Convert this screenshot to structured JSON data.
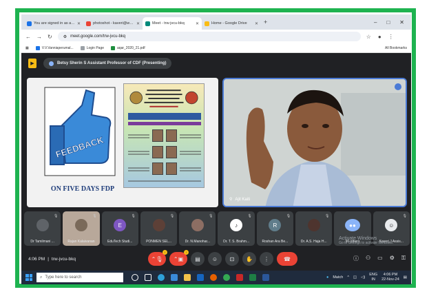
{
  "browser": {
    "tabs": [
      {
        "label": "You are signed in as agsc",
        "active": false,
        "color": "#1a73e8"
      },
      {
        "label": "photoshot - kaveri@wosdesgn -",
        "active": false,
        "color": "#ea4335"
      },
      {
        "label": "Meet - trw-jvcu-bkq",
        "active": true,
        "color": "#00897b"
      },
      {
        "label": "Home - Google Drive",
        "active": false,
        "color": "#f9bc15"
      }
    ],
    "url": "meet.google.com/trw-jvcu-bkq",
    "bookmarks": [
      "V.V.Vanniaperumal...",
      "Login Page",
      "aqar_2020_21.pdf"
    ],
    "all_bookmarks": "All Bookmarks"
  },
  "meet": {
    "presenting_label": "Betsy Sherin S Assistant Professor of CDF (Presenting)",
    "slide_caption": "ON FIVE DAYS FDP",
    "feedback_text": "FEEDBACK",
    "camera_name": "Ajit Kaiti",
    "participants": [
      {
        "name": "Dr Tamilmani ...",
        "initial": "",
        "color": "#5f6368"
      },
      {
        "name": "Rajan Kalaivanan",
        "initial": "",
        "color": "#7a6a5a"
      },
      {
        "name": "EduTech Studi...",
        "initial": "E",
        "color": "#7e57c2"
      },
      {
        "name": "PONMEN SEL...",
        "initial": "",
        "color": "#5d4037"
      },
      {
        "name": "Dr. N.Manohar...",
        "initial": "",
        "color": "#5f6368"
      },
      {
        "name": "Dr. T. S. Brahm...",
        "initial": "",
        "color": "#ffffff"
      },
      {
        "name": "Roshan Ara Be...",
        "initial": "R",
        "color": "#607d8b"
      },
      {
        "name": "Dr. A.S. Haja H...",
        "initial": "",
        "color": "#5f6368"
      },
      {
        "name": "90 others",
        "initial": "",
        "color": "#8ab4f8"
      },
      {
        "name": "Kaveri.J Assis...",
        "initial": "",
        "color": "#5f6368"
      }
    ],
    "time": "4:06 PM",
    "meeting_code": "trw-jvcu-bkq",
    "activate_title": "Activate Windows",
    "activate_sub": "Go to Settings to activate Windows."
  },
  "taskbar": {
    "search_placeholder": "Type here to search",
    "weather": "Match",
    "lang": "ENG",
    "lang_sub": "IN",
    "clock_time": "4:06 PM",
    "clock_date": "22-Nov-24"
  }
}
